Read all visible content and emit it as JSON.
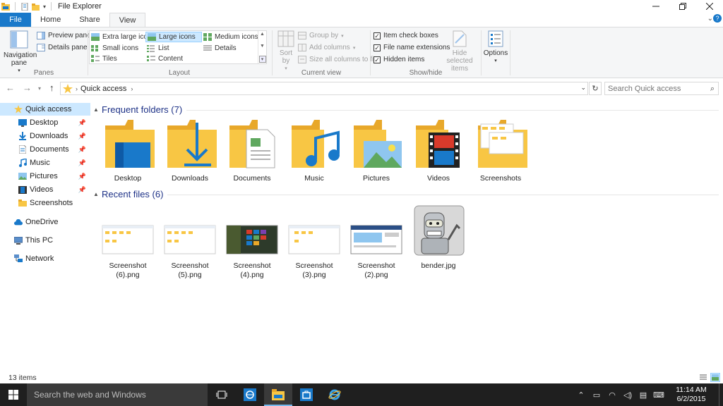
{
  "window": {
    "title": "File Explorer"
  },
  "tabs": [
    "File",
    "Home",
    "Share",
    "View"
  ],
  "ribbon": {
    "panes": {
      "label": "Panes",
      "navigation_pane": "Navigation pane",
      "preview_pane": "Preview pane",
      "details_pane": "Details pane"
    },
    "layout": {
      "label": "Layout",
      "options": [
        "Extra large icons",
        "Large icons",
        "Medium icons",
        "Small icons",
        "List",
        "Details",
        "Tiles",
        "Content"
      ],
      "selected": "Large icons"
    },
    "current_view": {
      "label": "Current view",
      "sort_by": "Sort by",
      "group_by": "Group by",
      "add_columns": "Add columns",
      "size_all_columns": "Size all columns to fit"
    },
    "show_hide": {
      "label": "Show/hide",
      "item_check_boxes": "Item check boxes",
      "file_name_extensions": "File name extensions",
      "hidden_items": "Hidden items",
      "hide_selected": "Hide selected items"
    },
    "options": "Options"
  },
  "address": {
    "crumb": "Quick access",
    "search_placeholder": "Search Quick access"
  },
  "sidebar": {
    "items": [
      {
        "label": "Quick access",
        "icon": "star-icon"
      },
      {
        "label": "Desktop",
        "icon": "desktop-icon"
      },
      {
        "label": "Downloads",
        "icon": "downloads-icon"
      },
      {
        "label": "Documents",
        "icon": "documents-icon"
      },
      {
        "label": "Music",
        "icon": "music-icon"
      },
      {
        "label": "Pictures",
        "icon": "pictures-icon"
      },
      {
        "label": "Videos",
        "icon": "videos-icon"
      },
      {
        "label": "Screenshots",
        "icon": "folder-icon"
      },
      {
        "label": "OneDrive",
        "icon": "onedrive-icon"
      },
      {
        "label": "This PC",
        "icon": "pc-icon"
      },
      {
        "label": "Network",
        "icon": "network-icon"
      }
    ]
  },
  "frequent": {
    "title": "Frequent folders (7)",
    "folders": [
      "Desktop",
      "Downloads",
      "Documents",
      "Music",
      "Pictures",
      "Videos",
      "Screenshots"
    ]
  },
  "recent": {
    "title": "Recent files (6)",
    "files": [
      "Screenshot (6).png",
      "Screenshot (5).png",
      "Screenshot (4).png",
      "Screenshot (3).png",
      "Screenshot (2).png",
      "bender.jpg"
    ]
  },
  "status": {
    "count": "13 items"
  },
  "taskbar": {
    "search_placeholder": "Search the web and Windows",
    "time": "11:14 AM",
    "date": "6/2/2015"
  },
  "colors": {
    "accent": "#1979ca",
    "folder": "#f8c644",
    "folder_dark": "#e8a82a",
    "selection": "#cce8ff"
  }
}
